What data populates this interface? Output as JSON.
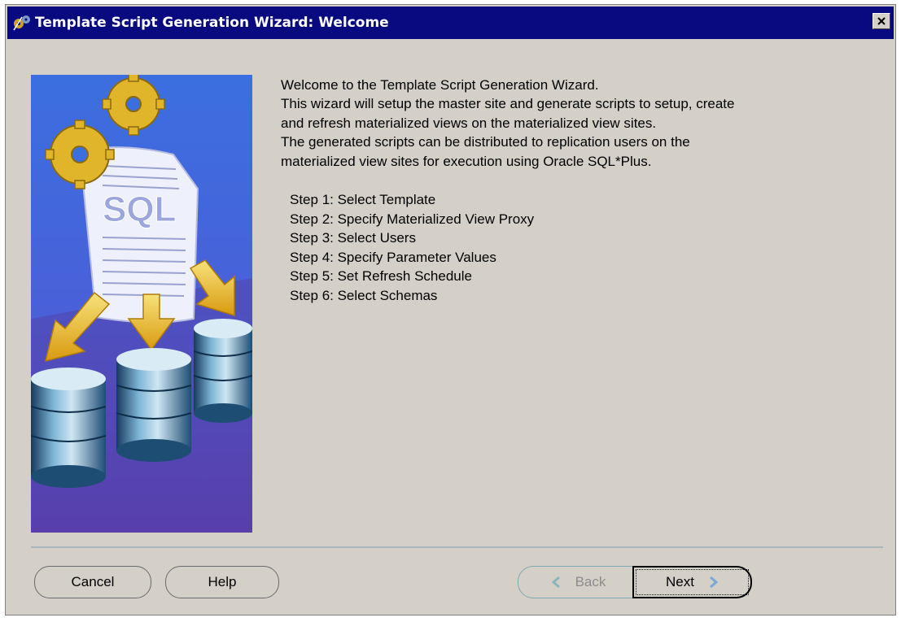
{
  "window": {
    "title": "Template Script Generation Wizard: Welcome"
  },
  "illustration": {
    "document_text": "SQL"
  },
  "intro": {
    "lines": [
      "Welcome to the Template Script Generation Wizard.",
      "This wizard will setup the master site and generate scripts to setup, create",
      "and refresh materialized views on the materialized view sites.",
      "The generated scripts can be distributed to replication users on the",
      "materialized view sites for execution using Oracle SQL*Plus."
    ]
  },
  "steps": [
    "Step 1: Select Template",
    "Step 2: Specify Materialized View Proxy",
    "Step 3: Select Users",
    "Step 4: Specify Parameter Values",
    "Step 5: Set Refresh Schedule",
    "Step 6: Select Schemas"
  ],
  "buttons": {
    "cancel": "Cancel",
    "help": "Help",
    "back": "Back",
    "next": "Next"
  },
  "icons": {
    "title": "wizard-gears-icon",
    "close": "close-icon",
    "back": "left-chevron-icon",
    "next": "right-chevron-icon"
  },
  "colors": {
    "titlebar": "#0a0a80",
    "window_bg": "#d4d0c8",
    "divider": "#aab8bd"
  }
}
